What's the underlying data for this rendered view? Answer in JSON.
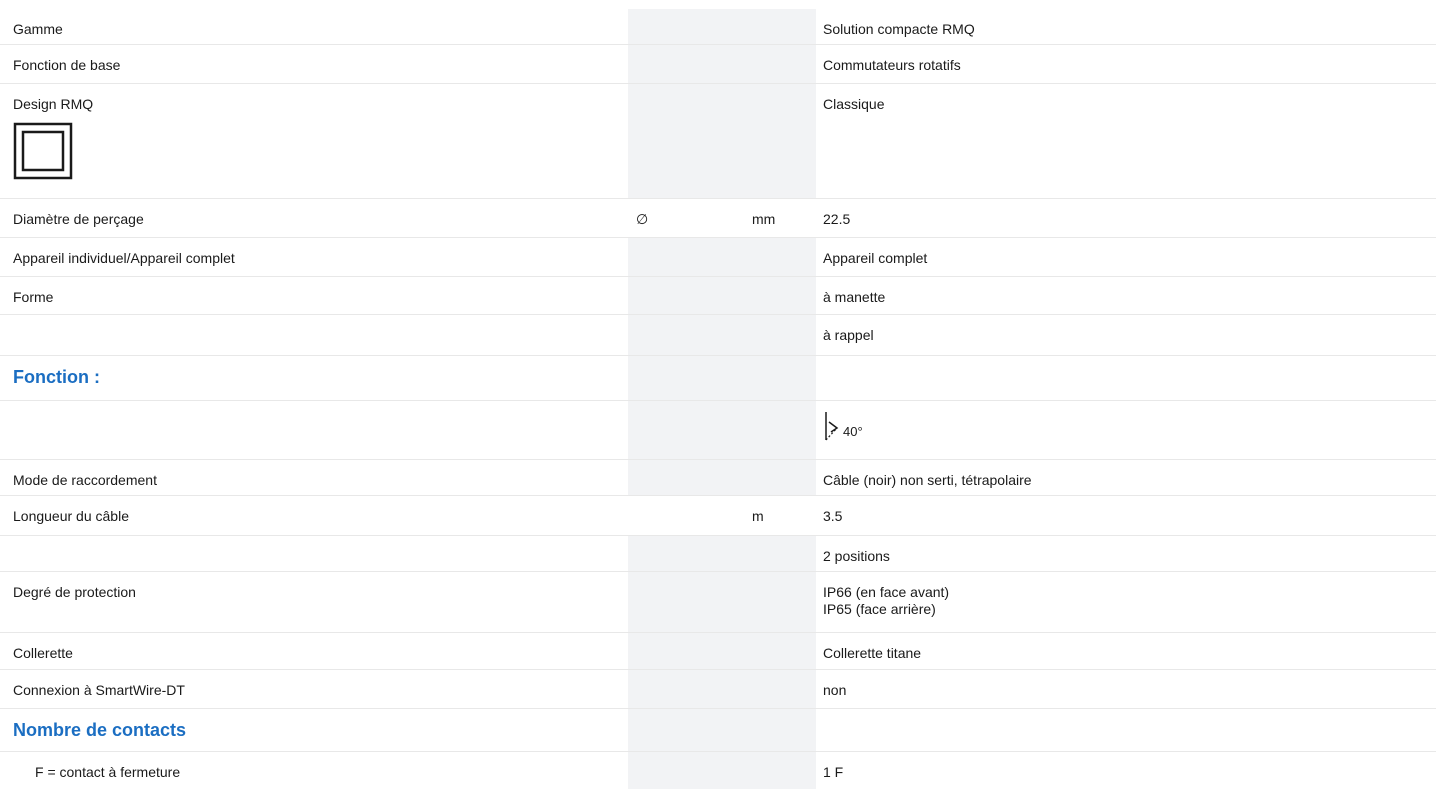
{
  "rows": [
    {
      "label": "Gamme",
      "symbol": "",
      "unit": "",
      "value": "Solution compacte RMQ"
    },
    {
      "label": "Fonction de base",
      "symbol": "",
      "unit": "",
      "value": "Commutateurs rotatifs"
    },
    {
      "label": "Design RMQ",
      "symbol": "",
      "unit": "",
      "value": "Classique",
      "icon": "square-frame-icon"
    },
    {
      "label": "Diamètre de perçage",
      "symbol": "∅",
      "unit": "mm",
      "value": "22.5"
    },
    {
      "label": "Appareil individuel/Appareil complet",
      "symbol": "",
      "unit": "",
      "value": "Appareil complet"
    },
    {
      "label": "Forme",
      "symbol": "",
      "unit": "",
      "value": "à manette"
    },
    {
      "label": "",
      "symbol": "",
      "unit": "",
      "value": "à rappel"
    },
    {
      "label": "Fonction :",
      "section": true
    },
    {
      "label": "",
      "symbol": "",
      "unit": "",
      "value": "40°",
      "icon": "rotation-angle-icon"
    },
    {
      "label": "Mode de raccordement",
      "symbol": "",
      "unit": "",
      "value": "Câble (noir) non serti, tétrapolaire"
    },
    {
      "label": "Longueur du câble",
      "symbol": "",
      "unit": "m",
      "value": "3.5"
    },
    {
      "label": "",
      "symbol": "",
      "unit": "",
      "value": "2 positions"
    },
    {
      "label": "Degré de protection",
      "symbol": "",
      "unit": "",
      "value_lines": [
        "IP66 (en face avant)",
        "IP65 (face arrière)"
      ]
    },
    {
      "label": "Collerette",
      "symbol": "",
      "unit": "",
      "value": "Collerette titane"
    },
    {
      "label": "Connexion à SmartWire-DT",
      "symbol": "",
      "unit": "",
      "value": "non"
    },
    {
      "label": "Nombre de contacts",
      "section": true
    },
    {
      "label": "F = contact à fermeture",
      "symbol": "",
      "unit": "",
      "value": "1 F",
      "indent": true
    }
  ],
  "colors": {
    "section_heading": "#1b6ec2",
    "shaded_column": "#f2f3f5",
    "row_divider": "#e8e8e8"
  }
}
